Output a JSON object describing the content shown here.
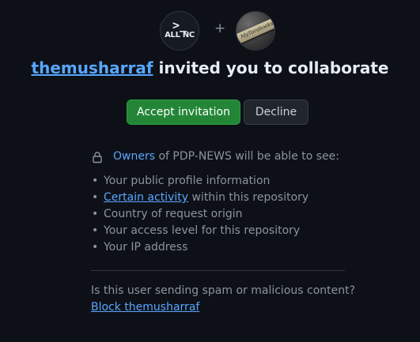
{
  "avatars": {
    "org_logo": {
      "prompt": ">_",
      "caption": "ALL NC"
    },
    "plus_sign": "+",
    "user_avatar": {
      "stripe_text": "MyTorabooks"
    }
  },
  "invite": {
    "inviter": "themusharraf",
    "message": " invited you to collaborate"
  },
  "actions": {
    "accept_label": "Accept invitation",
    "decline_label": "Decline"
  },
  "permissions": {
    "owners_link": "Owners",
    "owners_rest": " of PDP-NEWS will be able to see:",
    "items": [
      {
        "text": "Your public profile information"
      },
      {
        "link": "Certain activity",
        "text": " within this repository"
      },
      {
        "text": "Country of request origin"
      },
      {
        "text": "Your access level for this repository"
      },
      {
        "text": "Your IP address"
      }
    ]
  },
  "report": {
    "question": "Is this user sending spam or malicious content?",
    "block_label": "Block themusharraf"
  },
  "colors": {
    "background": "#0d1117",
    "link": "#58a6ff",
    "accept": "#238636",
    "decline": "#21262d"
  }
}
